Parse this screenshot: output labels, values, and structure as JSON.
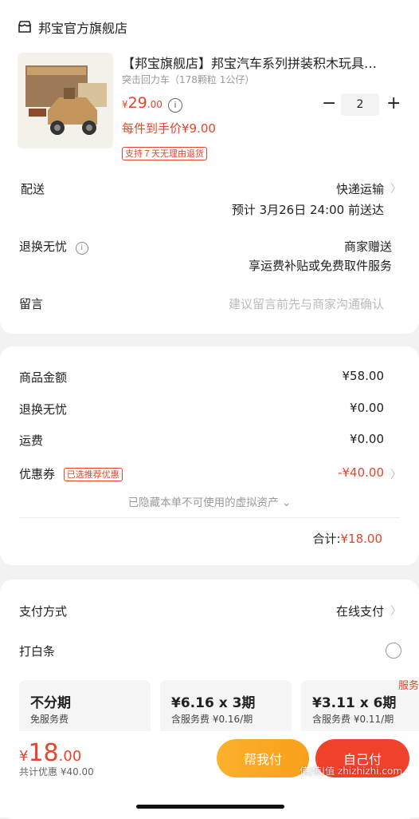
{
  "store": {
    "name": "邦宝官方旗舰店"
  },
  "product": {
    "title": "【邦宝旗舰店】邦宝汽车系列拼装积木玩具…",
    "spec": "突击回力车（178颗粒 1公仔）",
    "price_symbol": "¥",
    "price_int": "29",
    "price_dec": ".00",
    "unit_price": "每件到手价¥9.00",
    "return_tag": "支持７天无理由退货",
    "quantity": "2"
  },
  "delivery": {
    "label": "配送",
    "method": "快递运输",
    "eta": "预计 3月26日 24:00 前送达"
  },
  "returns": {
    "label": "退换无忧",
    "value": "商家赠送",
    "desc": "享运费补贴或免费取件服务"
  },
  "message": {
    "label": "留言",
    "placeholder": "建议留言前先与商家沟通确认"
  },
  "summary": {
    "goods_label": "商品金额",
    "goods_value": "¥58.00",
    "returns_label": "退换无忧",
    "returns_value": "¥0.00",
    "shipping_label": "运费",
    "shipping_value": "¥0.00",
    "coupon_label": "优惠券",
    "coupon_tag": "已选推荐优惠",
    "coupon_value": "-¥40.00",
    "hidden_note": "已隐藏本单不可使用的虚拟资产",
    "total_label": "合计:",
    "total_value": "¥18.00"
  },
  "payment": {
    "label": "支付方式",
    "value": "在线支付",
    "iou_label": "打白条"
  },
  "installments": [
    {
      "title": "不分期",
      "sub": "免服务费"
    },
    {
      "title": "¥6.16 x 3期",
      "sub": "含服务费 ¥0.16/期"
    },
    {
      "title": "¥3.11 x 6期",
      "sub": "含服务费 ¥0.11/期",
      "badge": "服务"
    }
  ],
  "footer": {
    "price_symbol": "¥",
    "price_int": "18",
    "price_dec": ".00",
    "discount": "共计优惠 ¥40.00",
    "help_pay": "帮我付",
    "self_pay": "自己付"
  },
  "watermark": "值|值|值 zhizhizhi.com",
  "colors": {
    "accent": "#e8432c",
    "help_pay_start": "#fbb12c",
    "self_pay": "#f0412c"
  }
}
